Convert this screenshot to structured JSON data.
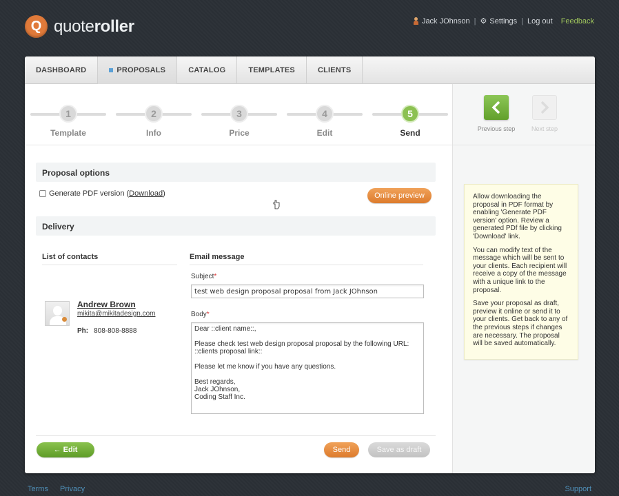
{
  "brand": {
    "logo_letter": "Q",
    "name_light": "quote",
    "name_bold": "roller"
  },
  "topnav": {
    "user": "Jack JOhnson",
    "settings": "Settings",
    "logout": "Log out",
    "feedback": "Feedback"
  },
  "tabs": [
    {
      "label": "DASHBOARD"
    },
    {
      "label": "PROPOSALS"
    },
    {
      "label": "CATALOG"
    },
    {
      "label": "TEMPLATES"
    },
    {
      "label": "CLIENTS"
    }
  ],
  "stepper": [
    {
      "num": "1",
      "label": "Template"
    },
    {
      "num": "2",
      "label": "Info"
    },
    {
      "num": "3",
      "label": "Price"
    },
    {
      "num": "4",
      "label": "Edit"
    },
    {
      "num": "5",
      "label": "Send"
    }
  ],
  "proposal_options": {
    "title": "Proposal options",
    "pdf_label": "Generate PDF version (",
    "download_link": "Download",
    "pdf_close": ")",
    "online_preview": "Online preview"
  },
  "delivery": {
    "title": "Delivery",
    "contacts_title": "List of contacts",
    "email_title": "Email message",
    "contact": {
      "name": "Andrew Brown",
      "email": "mikita@mikitadesign.com",
      "ph_label": "Ph:",
      "phone": "808-808-8888"
    },
    "subject_label": "Subject",
    "subject_value": "test web design proposal proposal from Jack JOhnson",
    "body_label": "Body",
    "body_value": "Dear ::client name::,\n\nPlease check test web design proposal proposal by the following URL:\n::clients proposal link::\n\nPlease let me know if you have any questions.\n\nBest regards,\nJack JOhnson,\nCoding Staff Inc.",
    "required_mark": "*"
  },
  "actions": {
    "edit": "← Edit",
    "send": "Send",
    "save_draft": "Save as draft"
  },
  "sidebar": {
    "prev_label": "Previous step",
    "next_label": "Next step",
    "tip_paragraphs": [
      "Allow downloading the proposal in PDF format by enabling 'Generate PDF version' option. Review a generated PDf file by clicking 'Download' link.",
      "You can modify text of the message which will be sent to your clients. Each recipient will receive a copy of the message with a unique link to the proposal.",
      "Save your proposal as draft, preview it online or send it to your clients. Get back to any of the previous steps if changes are necessary. The proposal will be saved automatically."
    ]
  },
  "footer": {
    "terms": "Terms",
    "privacy": "Privacy",
    "support": "Support"
  },
  "colors": {
    "accent_green": "#8cc152",
    "accent_orange": "#dd7b2c",
    "background": "#2b3036"
  }
}
